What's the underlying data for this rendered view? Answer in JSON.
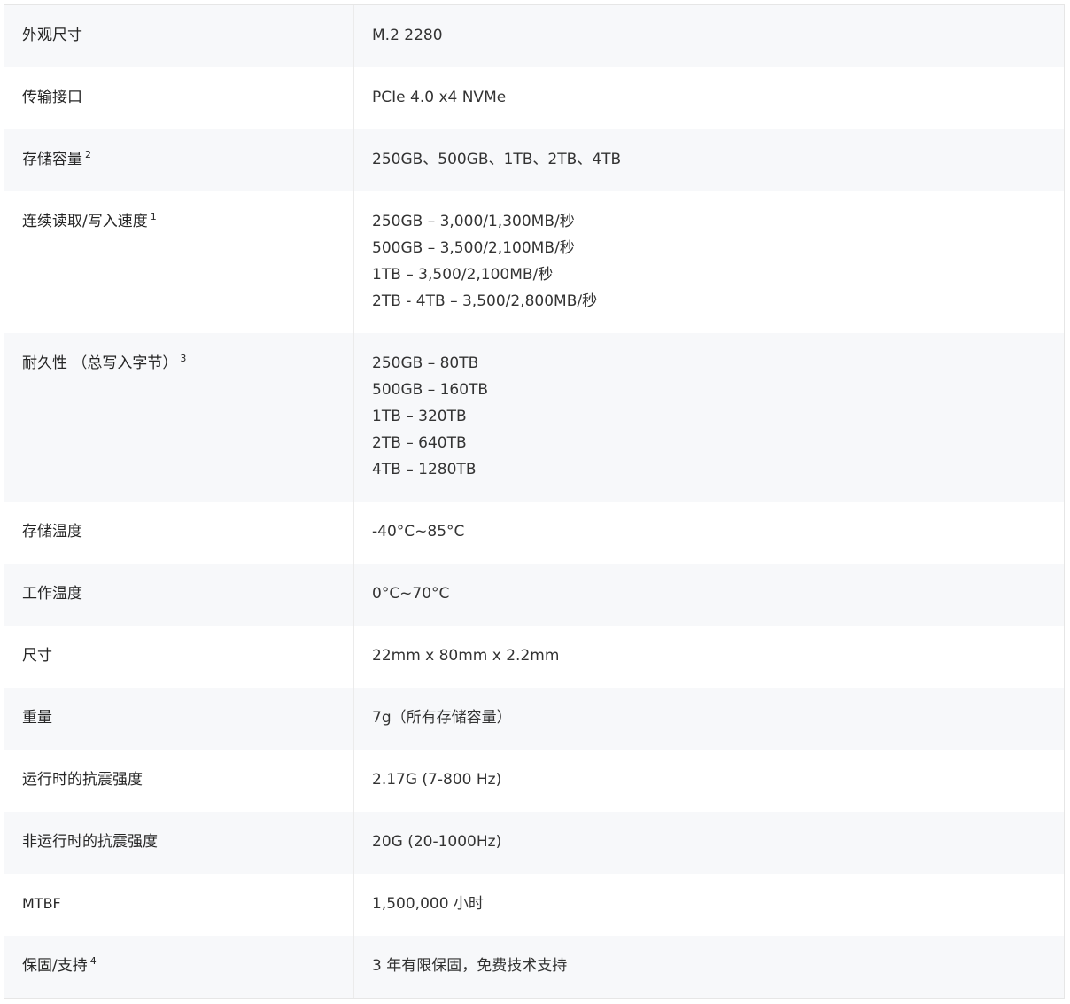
{
  "specs": [
    {
      "label": "外观尺寸",
      "sup": "",
      "values": [
        "M.2 2280"
      ]
    },
    {
      "label": "传输接口",
      "sup": "",
      "values": [
        "PCIe 4.0 x4 NVMe"
      ]
    },
    {
      "label": "存储容量",
      "sup": "2",
      "values": [
        "250GB、500GB、1TB、2TB、4TB"
      ]
    },
    {
      "label": "连续读取/写入速度",
      "sup": "1",
      "values": [
        "250GB – 3,000/1,300MB/秒",
        "500GB – 3,500/2,100MB/秒",
        "1TB – 3,500/2,100MB/秒",
        "2TB - 4TB – 3,500/2,800MB/秒"
      ]
    },
    {
      "label": "耐久性 （总写入字节）",
      "sup": "3",
      "values": [
        "250GB – 80TB",
        "500GB – 160TB",
        "1TB – 320TB",
        "2TB – 640TB",
        "4TB – 1280TB"
      ]
    },
    {
      "label": "存储温度",
      "sup": "",
      "values": [
        "-40°C~85°C"
      ]
    },
    {
      "label": "工作温度",
      "sup": "",
      "values": [
        "0°C~70°C"
      ]
    },
    {
      "label": "尺寸",
      "sup": "",
      "values": [
        "22mm x 80mm x 2.2mm"
      ]
    },
    {
      "label": "重量",
      "sup": "",
      "values": [
        "7g（所有存储容量）"
      ]
    },
    {
      "label": "运行时的抗震强度",
      "sup": "",
      "values": [
        "2.17G (7-800 Hz)"
      ]
    },
    {
      "label": "非运行时的抗震强度",
      "sup": "",
      "values": [
        "20G (20-1000Hz)"
      ]
    },
    {
      "label": "MTBF",
      "sup": "",
      "values": [
        "1,500,000 小时"
      ]
    },
    {
      "label": "保固/支持",
      "sup": "4",
      "values": [
        "3 年有限保固，免费技术支持"
      ]
    }
  ]
}
